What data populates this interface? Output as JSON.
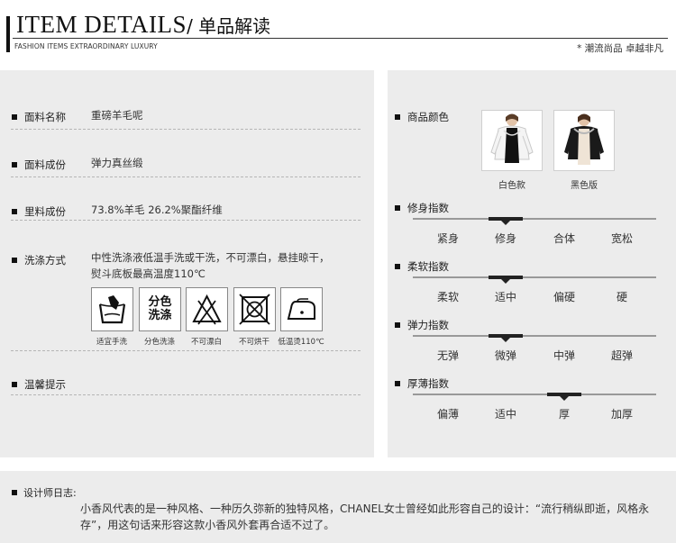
{
  "header": {
    "title_en": "ITEM DETAILS",
    "title_cn": "/ 单品解读",
    "subtitle": "FASHION ITEMS EXTRAORDINARY LUXURY",
    "slogan": "* 潮流尚品 卓越非凡"
  },
  "fabric": [
    {
      "label": "面料名称",
      "value": "重磅羊毛呢"
    },
    {
      "label": "面料成份",
      "value": "弹力真丝缎"
    },
    {
      "label": "里料成份",
      "value": "73.8%羊毛  26.2%聚酯纤维"
    }
  ],
  "washing": {
    "label": "洗涤方式",
    "line1": "中性洗涤液低温手洗或干洗，不可漂白，悬挂晾干，",
    "line2": "熨斗底板最高温度110℃",
    "icons": [
      {
        "name": "hand-wash-icon",
        "caption": "适宜手洗"
      },
      {
        "name": "separate-wash-icon",
        "caption": "分色洗涤",
        "text_top": "分色",
        "text_bottom": "洗涤"
      },
      {
        "name": "no-bleach-icon",
        "caption": "不可漂白"
      },
      {
        "name": "no-tumble-dry-icon",
        "caption": "不可烘干"
      },
      {
        "name": "low-iron-icon",
        "caption": "低温烫110℃"
      }
    ]
  },
  "tips": {
    "label": "温馨提示"
  },
  "colors": {
    "label": "商品颜色",
    "items": [
      {
        "caption": "白色款",
        "jacket_color": "#f4f4f4"
      },
      {
        "caption": "黑色版",
        "jacket_color": "#1a1a1a"
      }
    ]
  },
  "indices": [
    {
      "label": "修身指数",
      "options": [
        "紧身",
        "修身",
        "合体",
        "宽松"
      ],
      "selected": 1
    },
    {
      "label": "柔软指数",
      "options": [
        "柔软",
        "适中",
        "偏硬",
        "硬"
      ],
      "selected": 1
    },
    {
      "label": "弹力指数",
      "options": [
        "无弹",
        "微弹",
        "中弹",
        "超弹"
      ],
      "selected": 1
    },
    {
      "label": "厚薄指数",
      "options": [
        "偏薄",
        "适中",
        "厚",
        "加厚"
      ],
      "selected": 2
    }
  ],
  "designer": {
    "label": "设计师日志:",
    "text": "小香风代表的是一种风格、一种历久弥新的独特风格，CHANEL女士曾经如此形容自己的设计：“流行稍纵即逝，风格永存”，用这句话来形容这款小香风外套再合适不过了。"
  }
}
